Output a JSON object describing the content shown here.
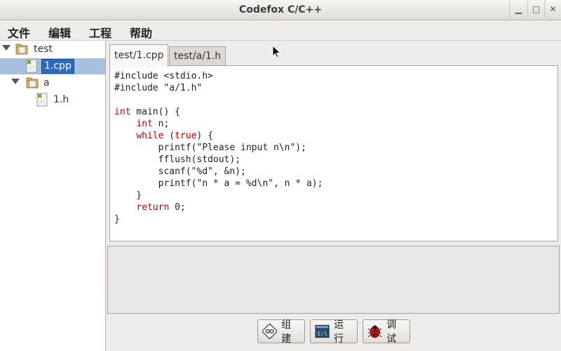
{
  "window": {
    "title": "Codefox C/C++",
    "buttons": [
      "minimize",
      "maximize",
      "close"
    ]
  },
  "menu": {
    "items": [
      "文件",
      "编辑",
      "工程",
      "帮助"
    ]
  },
  "project_tree": {
    "root": "test",
    "file_cpp": "1.cpp",
    "folder_a": "a",
    "file_h": "1.h"
  },
  "tabs": [
    {
      "label": "test/1.cpp",
      "active": true
    },
    {
      "label": "test/a/1.h",
      "active": false
    }
  ],
  "editor": {
    "lines": [
      "#include <stdio.h>",
      "#include \"a/1.h\"",
      "",
      "int main() {",
      "    int n;",
      "    while (true) {",
      "        printf(\"Please input n\\n\");",
      "        fflush(stdout);",
      "        scanf(\"%d\", &n);",
      "        printf(\"n * a = %d\\n\", n * a);",
      "    }",
      "    return 0;",
      "}"
    ],
    "keywords": [
      "int",
      "while",
      "true",
      "return"
    ],
    "keyword_color": "#c40000"
  },
  "actions": {
    "build": "组建",
    "run": "运行",
    "debug": "调试"
  }
}
